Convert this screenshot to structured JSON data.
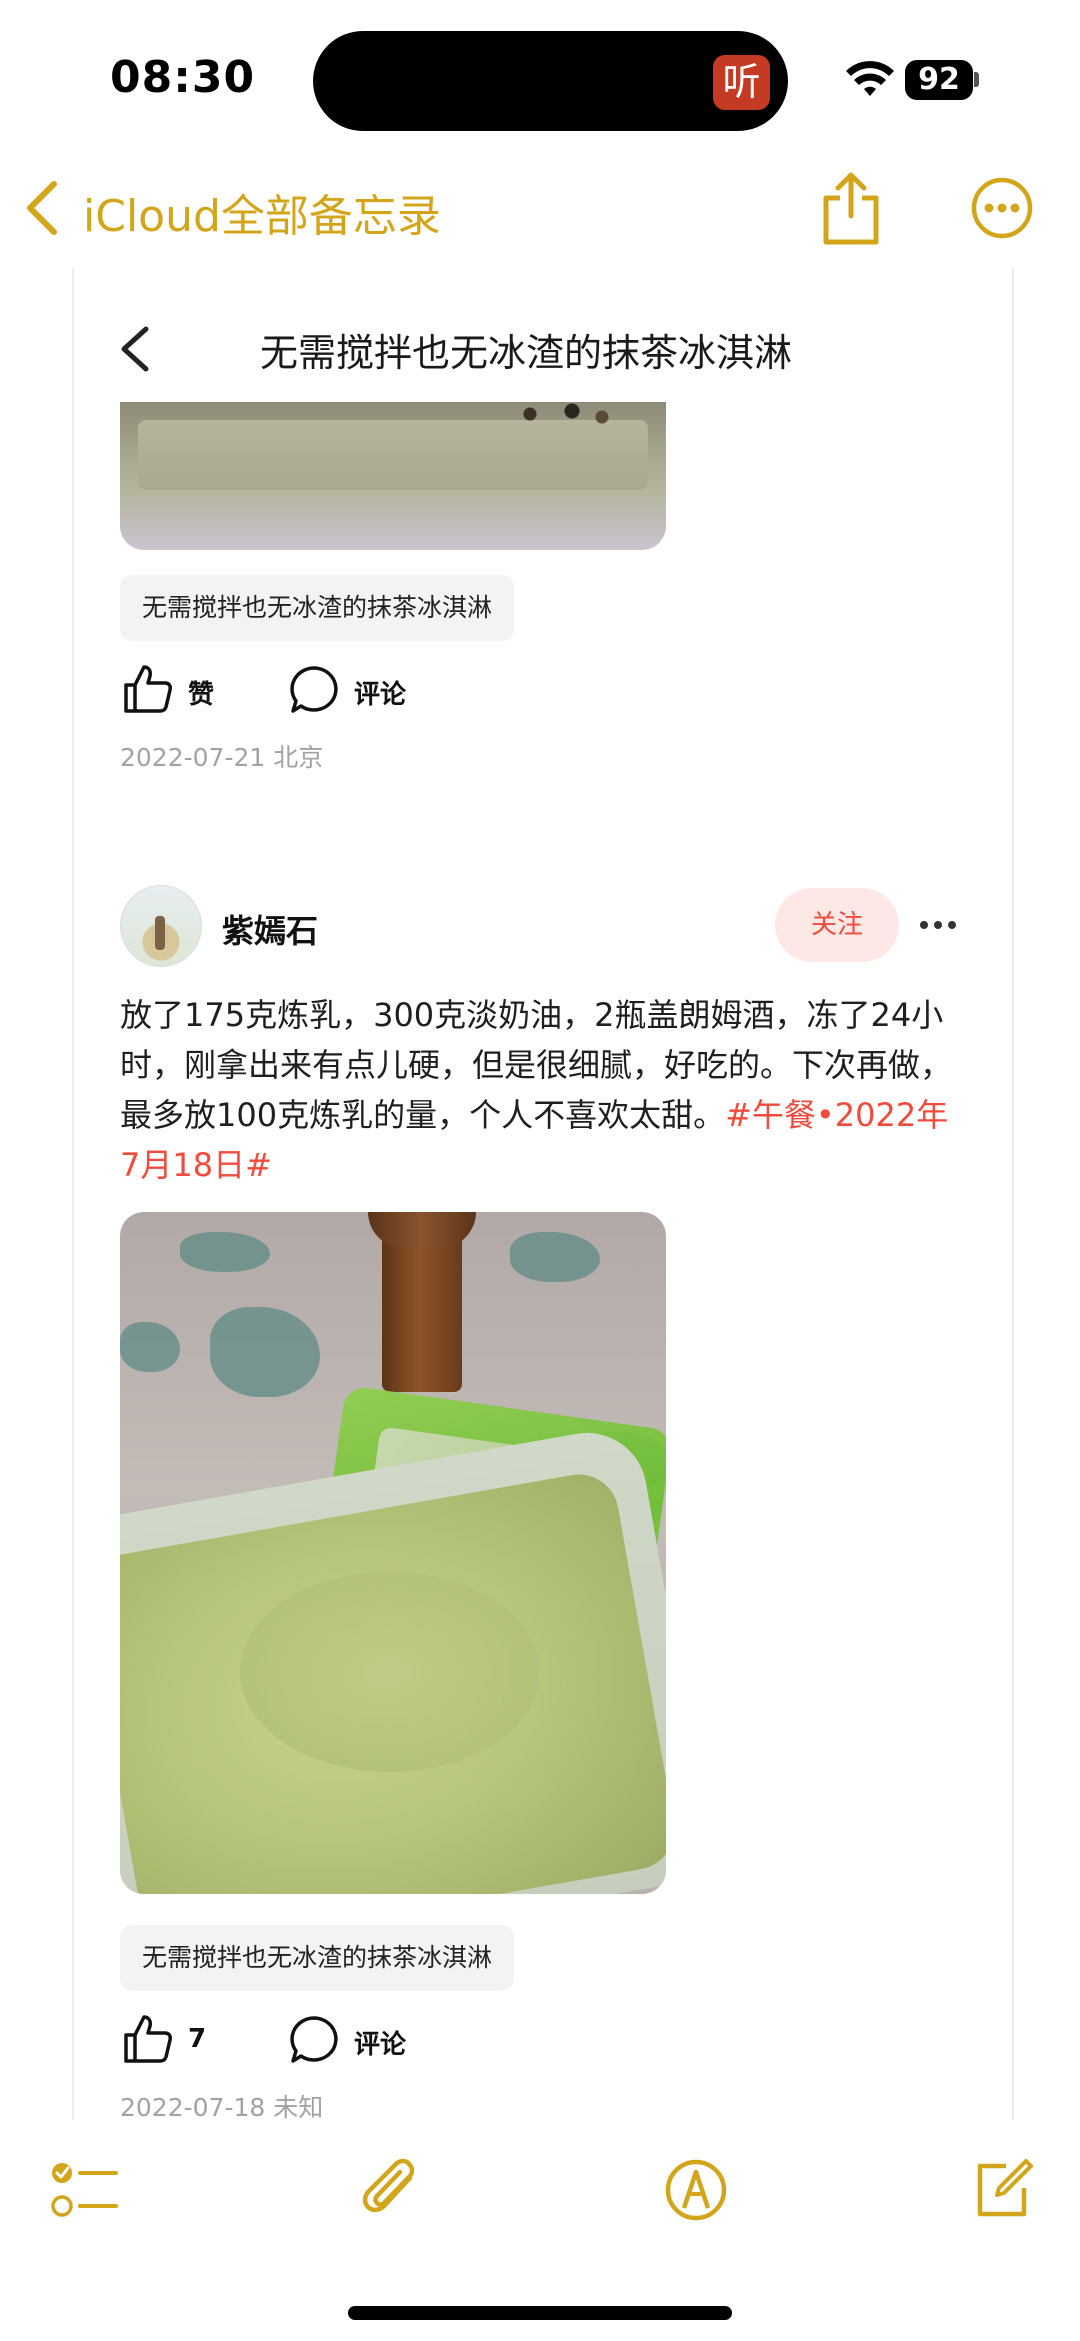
{
  "status_bar": {
    "time": "08:30",
    "listen_app_glyph": "听",
    "battery": "92"
  },
  "nav": {
    "back_label": "iCloud全部备忘录"
  },
  "article": {
    "title": "无需搅拌也无冰渣的抹茶冰淇淋"
  },
  "post1": {
    "caption": "无需搅拌也无冰渣的抹茶冰淇淋",
    "like_label": "赞",
    "comment_label": "评论",
    "meta": "2022-07-21 北京"
  },
  "post2": {
    "author": "紫嫣石",
    "follow_label": "关注",
    "text": "放了175克炼乳，300克淡奶油，2瓶盖朗姆酒，冻了24小时，刚拿出来有点儿硬，但是很细腻，好吃的。下次再做，最多放100克炼乳的量，个人不喜欢太甜。",
    "tag": "#午餐•2022年7月18日#",
    "caption": "无需搅拌也无冰渣的抹茶冰淇淋",
    "like_count": "7",
    "comment_label": "评论",
    "meta": "2022-07-18 未知"
  },
  "colors": {
    "accent": "#d3a51b",
    "tag": "#f24a3c",
    "meta": "#a2a2a2"
  },
  "icons": [
    "chevron-left-icon",
    "share-icon",
    "more-icon",
    "like-icon",
    "comment-icon",
    "checklist-icon",
    "paperclip-icon",
    "markup-icon",
    "compose-icon"
  ]
}
